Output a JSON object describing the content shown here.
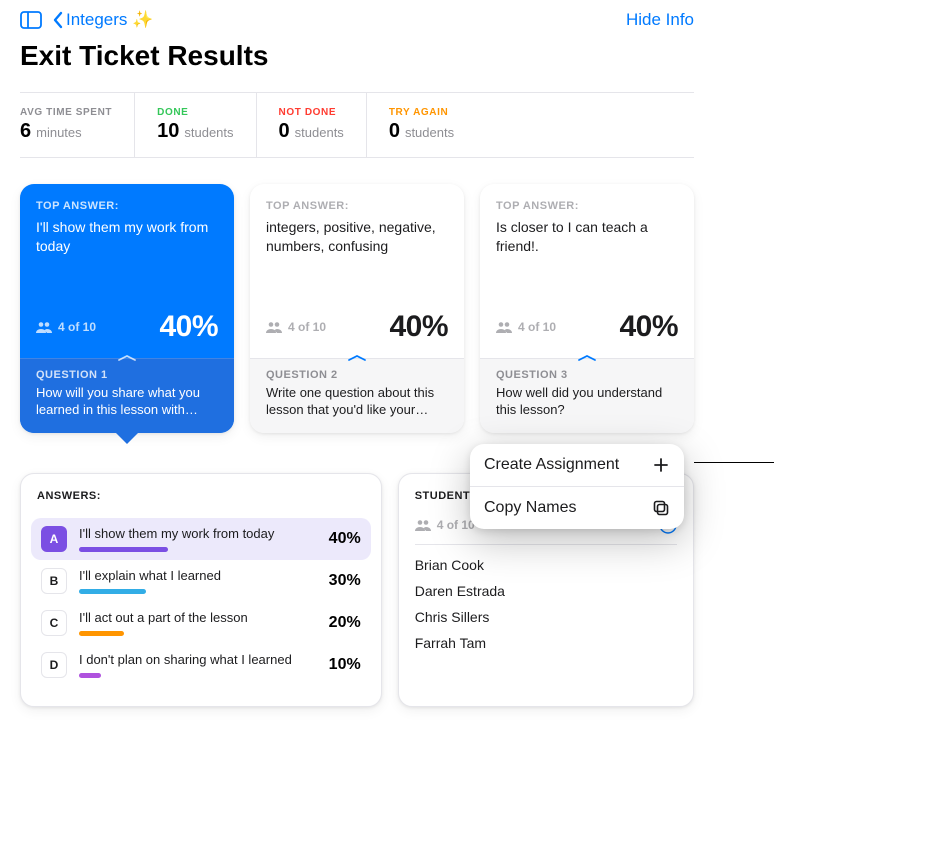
{
  "nav": {
    "back_label": "Integers ✨",
    "hide_info": "Hide Info"
  },
  "title": "Exit Ticket Results",
  "stats": {
    "avg_time": {
      "label": "AVG TIME SPENT",
      "value": "6",
      "unit": "minutes",
      "color": "#8e8e93"
    },
    "done": {
      "label": "DONE",
      "value": "10",
      "unit": "students",
      "color": "#34c759"
    },
    "not_done": {
      "label": "NOT DONE",
      "value": "0",
      "unit": "students",
      "color": "#ff3b30"
    },
    "try_again": {
      "label": "TRY AGAIN",
      "value": "0",
      "unit": "students",
      "color": "#ff9500"
    }
  },
  "questions": [
    {
      "tag": "TOP ANSWER:",
      "answer": "I'll show them my work from today",
      "count": "4 of 10",
      "pct": "40%",
      "qnum": "QUESTION 1",
      "qtext": "How will you share what you learned in this lesson with some…",
      "active": true
    },
    {
      "tag": "TOP ANSWER:",
      "answer": "integers, positive, negative, numbers, confusing",
      "count": "4 of 10",
      "pct": "40%",
      "qnum": "QUESTION 2",
      "qtext": "Write one question about this lesson that you'd like your teach…",
      "active": false
    },
    {
      "tag": "TOP ANSWER:",
      "answer": "Is closer to I can teach a friend!.",
      "count": "4 of 10",
      "pct": "40%",
      "qnum": "QUESTION 3",
      "qtext": "How well did you understand this lesson?",
      "active": false
    }
  ],
  "answers_panel": {
    "header": "ANSWERS:",
    "rows": [
      {
        "letter": "A",
        "text": "I'll show them my work from today",
        "pct": "40%",
        "bar_pct": 40,
        "color": "#7b4fe3",
        "selected": true
      },
      {
        "letter": "B",
        "text": "I'll explain what I learned",
        "pct": "30%",
        "bar_pct": 30,
        "color": "#32ade6",
        "selected": false
      },
      {
        "letter": "C",
        "text": "I'll act out a part of the lesson",
        "pct": "20%",
        "bar_pct": 20,
        "color": "#ff9500",
        "selected": false
      },
      {
        "letter": "D",
        "text": "I don't plan on sharing what I learned",
        "pct": "10%",
        "bar_pct": 10,
        "color": "#af52de",
        "selected": false
      }
    ]
  },
  "students_panel": {
    "header": "STUDENTS:",
    "count": "4 of 10",
    "names": [
      "Brian Cook",
      "Daren Estrada",
      "Chris Sillers",
      "Farrah Tam"
    ]
  },
  "popover": {
    "create": "Create Assignment",
    "copy": "Copy Names"
  }
}
